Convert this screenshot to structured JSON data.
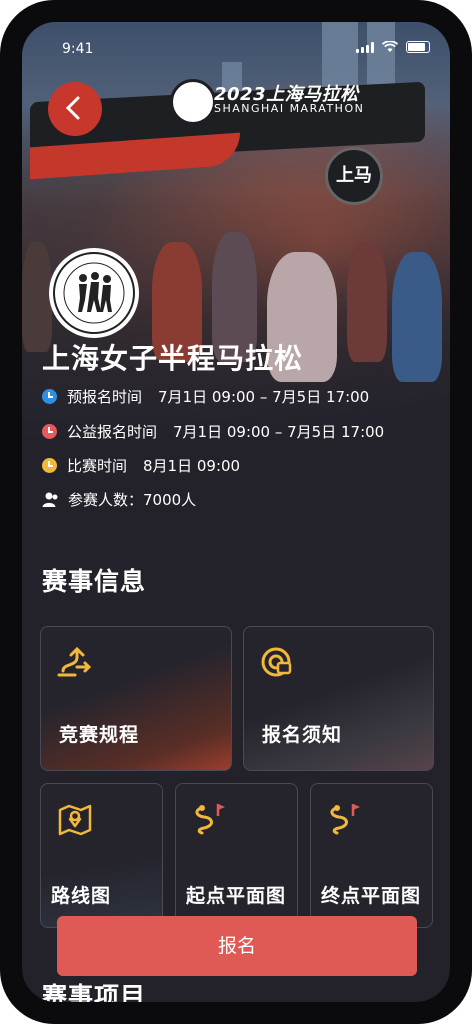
{
  "status_bar": {
    "time": "9:41"
  },
  "hero": {
    "banner_year_title": "2023上海马拉松",
    "banner_subtitle": "SHANGHAI MARATHON",
    "gate_sign": "上马",
    "back_icon": "chevron-left-icon"
  },
  "event": {
    "title": "上海女子半程马拉松",
    "info": [
      {
        "label": "预报名时间",
        "value": "7月1日 09:00 – 7月5日 17:00",
        "color": "#2f8fe0",
        "icon": "clock-icon"
      },
      {
        "label": "公益报名时间",
        "value": "7月1日 09:00 – 7月5日 17:00",
        "color": "#e25c5c",
        "icon": "clock-icon"
      },
      {
        "label": "比赛时间",
        "value": "8月1日 09:00",
        "color": "#f2b83a",
        "icon": "clock-icon"
      },
      {
        "label": "参赛人数：7000人",
        "value": "",
        "color": "#ffffff",
        "icon": "person-icon"
      }
    ]
  },
  "section_info": {
    "title": "赛事信息"
  },
  "cards": [
    {
      "label": "竞赛规程",
      "icon": "route-sign-icon"
    },
    {
      "label": "报名须知",
      "icon": "target-icon"
    },
    {
      "label": "路线图",
      "icon": "map-pin-icon"
    },
    {
      "label": "起点平面图",
      "icon": "route-flag-icon"
    },
    {
      "label": "终点平面图",
      "icon": "route-flag-icon"
    }
  ],
  "colors": {
    "accent": "#e05a55",
    "icon_yellow": "#f2b83a",
    "background": "#23222b"
  },
  "signup_button": {
    "label": "报名"
  },
  "section_items": {
    "title": "赛事项目"
  }
}
